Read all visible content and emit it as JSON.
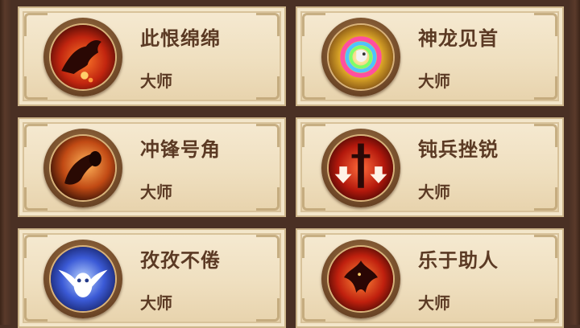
{
  "achievements": [
    {
      "title": "此恨绵绵",
      "rank": "大师",
      "icon": "red-horse-icon"
    },
    {
      "title": "神龙见首",
      "rank": "大师",
      "icon": "rainbow-dragon-icon"
    },
    {
      "title": "冲锋号角",
      "rank": "大师",
      "icon": "war-horn-icon"
    },
    {
      "title": "钝兵挫锐",
      "rank": "大师",
      "icon": "broken-sword-icon"
    },
    {
      "title": "孜孜不倦",
      "rank": "大师",
      "icon": "white-owl-icon"
    },
    {
      "title": "乐于助人",
      "rank": "大师",
      "icon": "fire-bird-icon"
    }
  ],
  "colors": {
    "card_bg": "#f3e6ca",
    "text": "#5b3a24",
    "frame": "#4a3024"
  }
}
